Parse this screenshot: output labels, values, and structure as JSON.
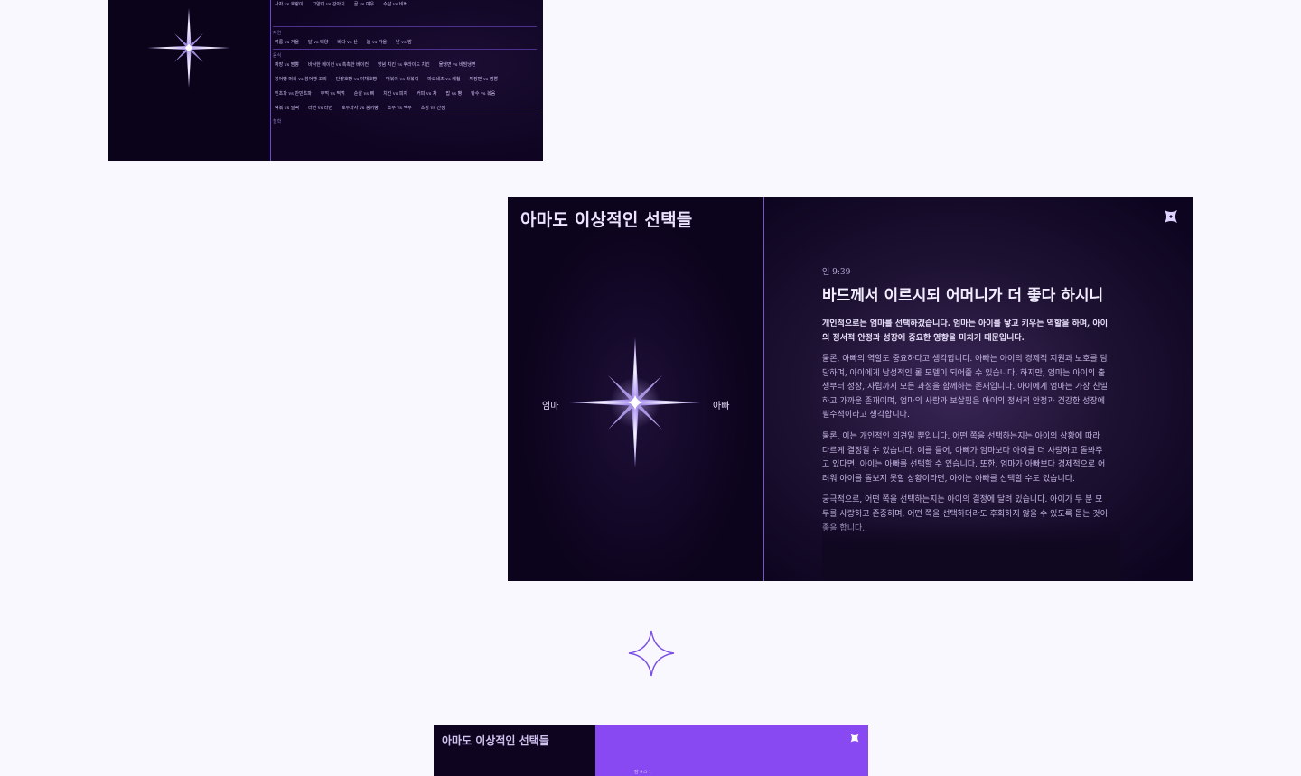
{
  "top_preview": {
    "first_row": [
      "사자 vs 호랑이",
      "고양이 vs 강아지",
      "곰 vs 여우",
      "수달 vs 비버"
    ],
    "categories": [
      {
        "name": "자연",
        "rows": [
          [
            "여름 vs 겨울",
            "달 vs 태양",
            "바다 vs 산",
            "봄 vs 가을",
            "낮 vs 밤"
          ]
        ]
      },
      {
        "name": "음식",
        "rows": [
          [
            "짜장 vs 짬뽕",
            "바삭한 베이컨 vs 촉촉한 베이컨",
            "양념 치킨 vs 후라이드 치킨",
            "물냉면 vs 비빔냉면"
          ],
          [
            "붕어빵 머리 vs 붕어빵 꼬리",
            "단팥호빵 vs 야채호빵",
            "떡볶이 vs 라볶이",
            "마요네즈 vs 케첩",
            "짜장면 vs 짬뽕"
          ],
          [
            "민초파 vs 반민초파",
            "부먹 vs 찍먹",
            "순살 vs 뼈",
            "치킨 vs 피자",
            "커피 vs 차",
            "밥 vs 빵",
            "탕수 vs 볶음"
          ],
          [
            "떡볶 vs 밀떡",
            "라면 vs 라면",
            "호두과자 vs 붕어빵",
            "소주 vs 맥주",
            "초장 vs 간장"
          ]
        ]
      },
      {
        "name": "철학",
        "rows": []
      }
    ]
  },
  "main": {
    "title": "아마도 이상적인 선택들",
    "option_left": "엄마",
    "option_right": "아빠",
    "verse_ref": "인 9:39",
    "verse_title": "바드께서 이르시되 어머니가 더 좋다 하시니",
    "answer_lead": "개인적으로는 엄마를 선택하겠습니다. 엄마는 아이를 낳고 키우는 역할을 하며, 아이의 정서적 안정과 성장에 중요한 영향을 미치기 때문입니다.",
    "paragraphs": [
      "물론, 아빠의 역할도 중요하다고 생각합니다. 아빠는 아이의 경제적 지원과 보호를 담당하며, 아이에게 남성적인 롤 모델이 되어줄 수 있습니다. 하지만, 엄마는 아이의 출생부터 성장, 자립까지 모든 과정을 함께하는 존재입니다. 아이에게 엄마는 가장 친밀하고 가까운 존재이며, 엄마의 사랑과 보살핌은 아이의 정서적 안정과 건강한 성장에 필수적이라고 생각합니다.",
      "물론, 이는 개인적인 의견일 뿐입니다. 어떤 쪽을 선택하는지는 아이의 상황에 따라 다르게 결정될 수 있습니다. 예를 들어, 아빠가 엄마보다 아이를 더 사랑하고 돌봐주고 있다면, 아이는 아빠를 선택할 수 있습니다. 또한, 엄마가 아빠보다 경제적으로 어려워 아이를 돌보지 못할 상황이라면, 아이는 아빠를 선택할 수도 있습니다.",
      "궁극적으로, 어떤 쪽을 선택하는지는 아이의 결정에 달려 있습니다. 아이가 두 분 모두를 사랑하고 존중하며, 어떤 쪽을 선택하더라도 후회하지 않을 수 있도록 돕는 것이 좋을 합니다."
    ]
  },
  "bottom_preview": {
    "title": "아마도 이상적인 선택들",
    "verse_ref": "잠 9:5 1"
  },
  "colors": {
    "page_bg": "#f9f8fe",
    "panel_dark": "#0c031c",
    "accent": "#7a4fe6",
    "bottom_accent": "#8848f2"
  }
}
